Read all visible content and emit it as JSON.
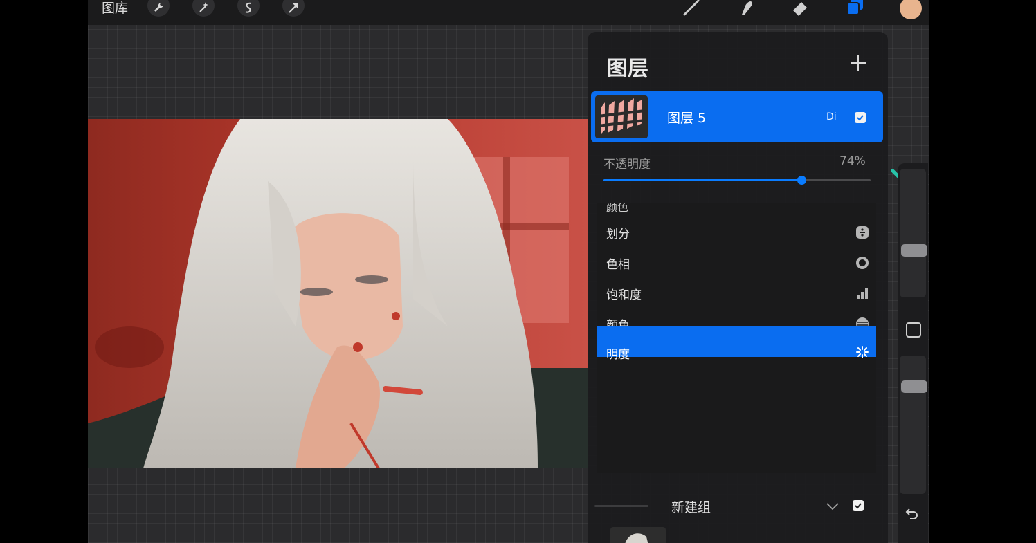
{
  "toolbar": {
    "gallery_label": "图库",
    "left_tools": [
      "wrench-icon",
      "magic-wand-icon",
      "selection-icon",
      "transform-arrow-icon"
    ],
    "right_tools": [
      "brush-icon",
      "smudge-icon",
      "eraser-icon",
      "layers-icon"
    ],
    "color_swatch": "#e8b48e",
    "accent_color": "#0a6df0"
  },
  "layers_panel": {
    "title": "图层",
    "add_icon": "plus-icon",
    "active_layer": {
      "name": "图层 5",
      "blend_mode_short": "Di",
      "visible": true
    },
    "opacity": {
      "label": "不透明度",
      "value_text": "74%",
      "value": 0.74
    },
    "blend_modes": {
      "cut_off_label": "颜色",
      "items": [
        {
          "label": "划分",
          "icon": "divide-icon"
        },
        {
          "label": "色相",
          "icon": "hue-icon"
        },
        {
          "label": "饱和度",
          "icon": "saturation-icon"
        },
        {
          "label": "颜色",
          "icon": "color-icon"
        },
        {
          "label": "明度",
          "icon": "luminosity-icon",
          "selected": true
        }
      ]
    },
    "group": {
      "name": "新建组",
      "expanded_icon": "chevron-down-icon",
      "visible": true
    }
  },
  "sidebar": {
    "size_level": 0.35,
    "opacity_level": 0.8,
    "undo_icon": "undo-icon"
  }
}
